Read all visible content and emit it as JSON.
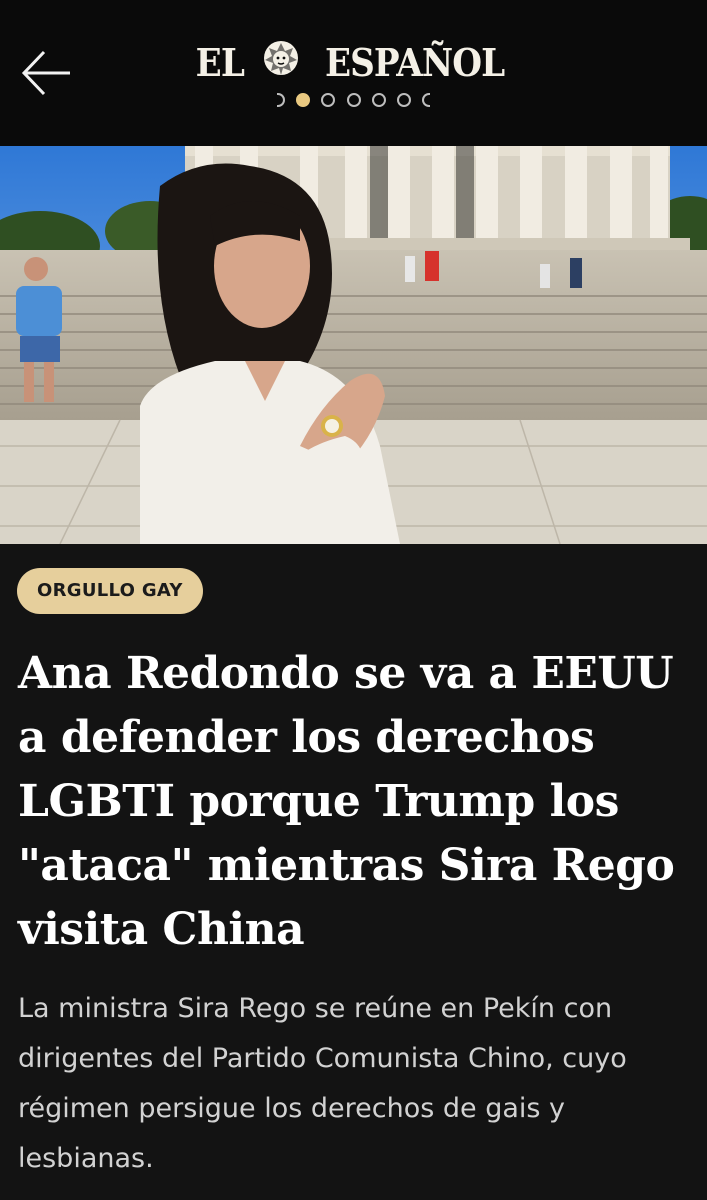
{
  "header": {
    "logo_left": "EL",
    "logo_right": "ESPAÑOL",
    "back_icon": "arrow-left-icon",
    "logo_icon": "lion-head-icon",
    "page_indicator": {
      "total_visible": 5,
      "active_index": 0
    }
  },
  "hero": {
    "image_desc_icon": "photo-image"
  },
  "article": {
    "category": "ORGULLO GAY",
    "headline": "Ana Redondo se va a EEUU a defender los derechos LGBTI porque Trump los \"ataca\" mientras Sira Rego visita China",
    "summary": "La ministra Sira Rego se reúne en Pekín con dirigentes del Partido Comunista Chino, cuyo régimen persigue los derechos de gais y lesbianas."
  },
  "colors": {
    "header_bg": "#0a0a0a",
    "content_bg": "#131313",
    "accent": "#e6cf9c",
    "headline": "#ffffff",
    "summary": "#d2d2d2"
  }
}
